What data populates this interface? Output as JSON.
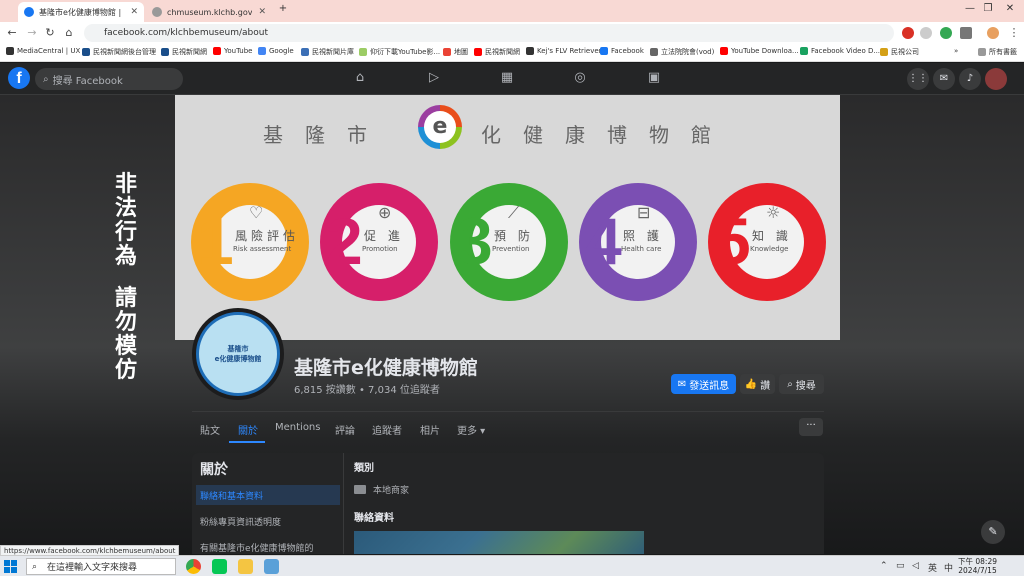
{
  "browser": {
    "tabs": [
      {
        "title": "基隆市e化健康博物館 | Facebo",
        "active": true
      },
      {
        "title": "chmuseum.klchb.gov.tw",
        "active": false
      }
    ],
    "new_tab": "+",
    "url": "facebook.com/klchbemuseum/about",
    "bookmarks": [
      "MediaCentral | UX",
      "民視新聞網後台管理",
      "民視新聞網",
      "YouTube",
      "Google",
      "民視新聞片庫",
      "仰衍下載YouTube影...",
      "地圖",
      "民視新聞網",
      "Kej's FLV Retriever",
      "Facebook",
      "立法院院會(vod)",
      "YouTube Downloa...",
      "Facebook Video D...",
      "民視公司"
    ],
    "bookmarks_more": "»",
    "all_bookmarks": "所有書籤"
  },
  "facebook": {
    "logo": "f",
    "search_placeholder": "搜尋 Facebook"
  },
  "cover": {
    "side_slogan_top": "非法行為",
    "side_slogan_bottom": "請勿模仿",
    "title_left": "基隆市",
    "logo_letter": "e",
    "title_right": "化健康博物館",
    "circles": [
      {
        "num": "1",
        "zh": "風險評估",
        "en": "Risk assessment",
        "color": "#f5a623",
        "icon": "heart-icon"
      },
      {
        "num": "2",
        "zh": "促 進",
        "en": "Promotion",
        "color": "#d61f6a",
        "icon": "medkit-icon"
      },
      {
        "num": "3",
        "zh": "預 防",
        "en": "Prevention",
        "color": "#3aa935",
        "icon": "syringe-icon"
      },
      {
        "num": "4",
        "zh": "照 護",
        "en": "Health care",
        "color": "#7b4fb3",
        "icon": "bed-icon"
      },
      {
        "num": "5",
        "zh": "知 識",
        "en": "Knowledge",
        "color": "#e8202a",
        "icon": "bulb-icon"
      }
    ]
  },
  "profile": {
    "pic_line1": "基隆市",
    "pic_line2": "e化健康博物館",
    "name": "基隆市e化健康博物館",
    "stats": "6,815 按讚數 • 7,034 位追蹤者",
    "message_button": "發送訊息",
    "like_button": "讚",
    "search_button": "搜尋"
  },
  "page_tabs": [
    "貼文",
    "關於",
    "Mentions",
    "評論",
    "追蹤者",
    "相片",
    "更多 ▾"
  ],
  "more_button": "···",
  "about": {
    "title": "關於",
    "nav": [
      "聯絡和基本資料",
      "粉絲專頁資訊透明度",
      "有關基隆市e化健康博物館的"
    ],
    "category_heading": "類別",
    "category_value": "本地商家",
    "contact_heading": "聯絡資料"
  },
  "status_url": "https://www.facebook.com/klchbemuseum/about",
  "taskbar": {
    "search_placeholder": "在這裡輸入文字來搜尋",
    "clock_time": "下午 08:29",
    "clock_date": "2024/7/15",
    "ime": "英",
    "ime2": "中"
  }
}
